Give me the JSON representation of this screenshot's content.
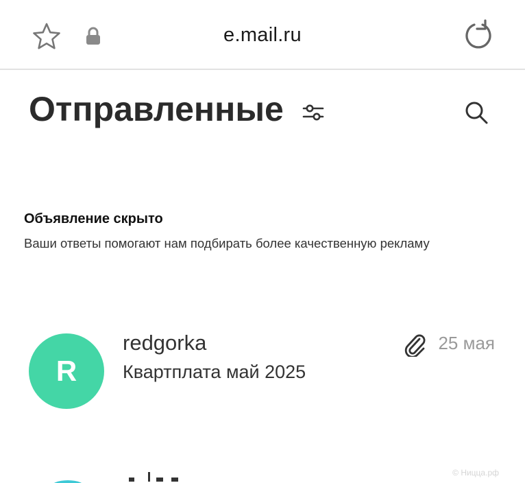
{
  "browser": {
    "domain": "e.mail.ru",
    "icons": {
      "star": "star-icon",
      "lock": "lock-icon",
      "reload": "reload-icon"
    }
  },
  "header": {
    "title": "Отправленные",
    "icons": {
      "filter": "sliders-icon",
      "search": "search-icon"
    }
  },
  "ad_notice": {
    "title": "Объявление скрыто",
    "text": "Ваши ответы помогают нам подбирать более качественную рекламу"
  },
  "messages": [
    {
      "avatar_letter": "R",
      "avatar_color": "#44d6a6",
      "sender": "redgorka",
      "subject": "Квартплата май 2025",
      "has_attachment": true,
      "date": "25 мая"
    }
  ],
  "watermark": "© Ницца.рф",
  "colors": {
    "accent_green": "#44d6a6",
    "date_gray": "#9a9a9a"
  }
}
